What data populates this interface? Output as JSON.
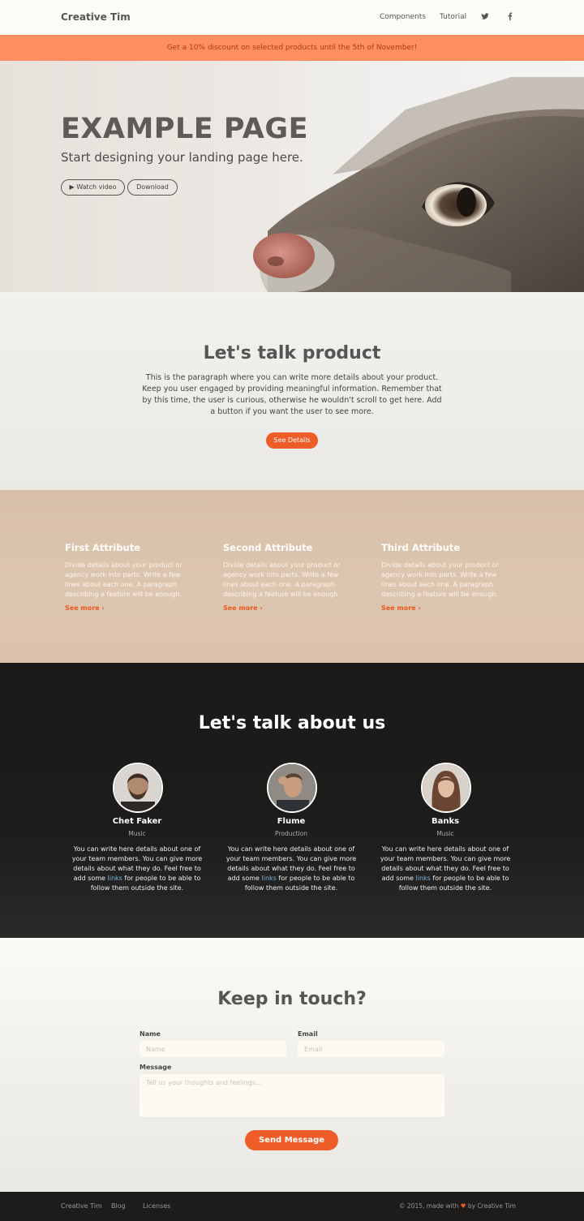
{
  "navbar": {
    "brand": "Creative Tim",
    "links": [
      "Components",
      "Tutorial"
    ],
    "icons": [
      "twitter-icon",
      "facebook-icon"
    ]
  },
  "banner": {
    "text": "Get a 10% discount on selected products until the 5th of November!"
  },
  "hero": {
    "title": "EXAMPLE PAGE",
    "subtitle": "Start designing your landing page here.",
    "watch_label": "Watch video",
    "download_label": "Download"
  },
  "product": {
    "title": "Let's talk product",
    "text": "This is the paragraph where you can write more details about your product. Keep you user engaged by providing meaningful information. Remember that by this time, the user is curious, otherwise he wouldn't scroll to get here. Add a button if you want the user to see more.",
    "button": "See Details"
  },
  "features": [
    {
      "title": "First Attribute",
      "text": "Divide details about your product or agency work into parts. Write a few lines about each one. A paragraph describing a feature will be enough.",
      "link": "See more"
    },
    {
      "title": "Second Attribute",
      "text": "Divide details about your product or agency work into parts. Write a few lines about each one. A paragraph describing a feature will be enough.",
      "link": "See more"
    },
    {
      "title": "Third Attribute",
      "text": "Divide details about your product or agency work into parts. Write a few lines about each one. A paragraph describing a feature will be enough.",
      "link": "See more"
    }
  ],
  "team": {
    "title": "Let's talk about us",
    "desc_before": "You can write here details about one of your team members. You can give more details about what they do. Feel free to add some ",
    "desc_link": "links",
    "desc_after": " for people to be able to follow them outside the site.",
    "members": [
      {
        "name": "Chet Faker",
        "role": "Music"
      },
      {
        "name": "Flume",
        "role": "Production"
      },
      {
        "name": "Banks",
        "role": "Music"
      }
    ]
  },
  "contact": {
    "title": "Keep in touch?",
    "name_label": "Name",
    "name_placeholder": "Name",
    "email_label": "Email",
    "email_placeholder": "Email",
    "message_label": "Message",
    "message_placeholder": "Tell us your thoughts and feelings...",
    "button": "Send Message"
  },
  "footer": {
    "links": [
      "Creative Tim",
      "Blog",
      "Licenses"
    ],
    "copy_before": "© 2015, made with ",
    "copy_after": " by Creative Tim"
  },
  "colors": {
    "accent": "#ee5d27",
    "banner": "#ff8f5e",
    "dark": "#1d1c1b",
    "features_bg": "#d9c2ab"
  }
}
